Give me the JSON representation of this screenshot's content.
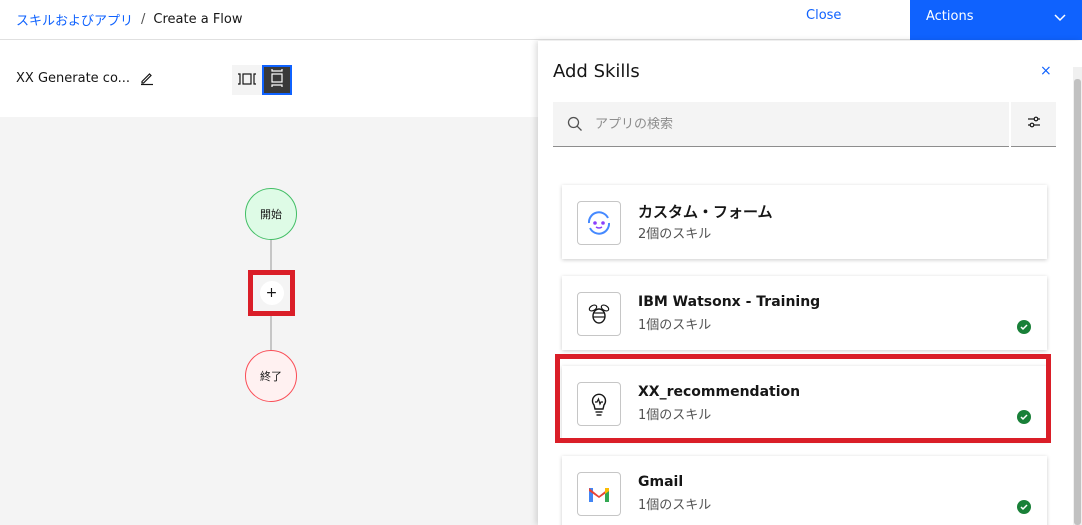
{
  "header": {
    "breadcrumb_root": "スキルおよびアプリ",
    "breadcrumb_sep": "/",
    "breadcrumb_current": "Create a Flow",
    "close_label": "Close",
    "actions_label": "Actions"
  },
  "flow": {
    "name": "XX Generate co...",
    "start_label": "開始",
    "add_label": "+",
    "end_label": "終了"
  },
  "panel": {
    "title": "Add Skills",
    "close_glyph": "×",
    "search_placeholder": "アプリの検索",
    "skills": [
      {
        "name": "カスタム・フォーム",
        "count": "2個のスキル",
        "icon": "custom-form-icon",
        "added": false
      },
      {
        "name": "IBM Watsonx - Training",
        "count": "1個のスキル",
        "icon": "bee-icon",
        "added": true
      },
      {
        "name": "XX_recommendation",
        "count": "1個のスキル",
        "icon": "lightbulb-icon",
        "added": true,
        "highlighted": true
      },
      {
        "name": "Gmail",
        "count": "1個のスキル",
        "icon": "gmail-icon",
        "added": true
      }
    ]
  },
  "colors": {
    "primary": "#0f62fe",
    "highlight": "#da1e28",
    "start_fill": "#defbe6",
    "end_fill": "#fff1f1",
    "check": "#198038"
  }
}
